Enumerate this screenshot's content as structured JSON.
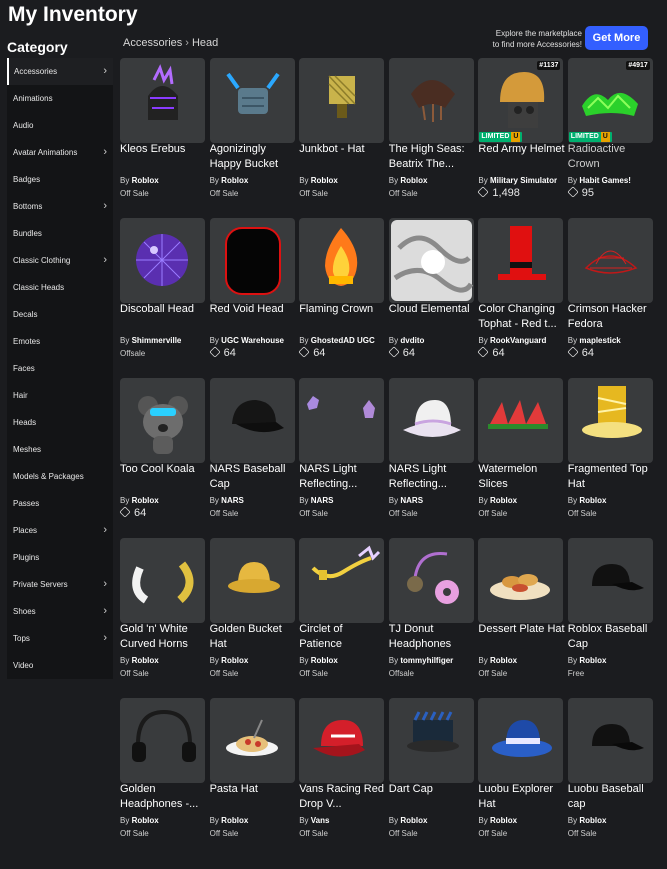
{
  "page_title": "My Inventory",
  "category_title": "Category",
  "sidebar": {
    "items": [
      {
        "label": "Accessories",
        "chevron": true,
        "active": true
      },
      {
        "label": "Animations",
        "chevron": false
      },
      {
        "label": "Audio",
        "chevron": false
      },
      {
        "label": "Avatar Animations",
        "chevron": true
      },
      {
        "label": "Badges",
        "chevron": false
      },
      {
        "label": "Bottoms",
        "chevron": true
      },
      {
        "label": "Bundles",
        "chevron": false
      },
      {
        "label": "Classic Clothing",
        "chevron": true
      },
      {
        "label": "Classic Heads",
        "chevron": false
      },
      {
        "label": "Decals",
        "chevron": false
      },
      {
        "label": "Emotes",
        "chevron": false
      },
      {
        "label": "Faces",
        "chevron": false
      },
      {
        "label": "Hair",
        "chevron": false
      },
      {
        "label": "Heads",
        "chevron": false
      },
      {
        "label": "Meshes",
        "chevron": false
      },
      {
        "label": "Models & Packages",
        "chevron": false
      },
      {
        "label": "Passes",
        "chevron": false
      },
      {
        "label": "Places",
        "chevron": true
      },
      {
        "label": "Plugins",
        "chevron": false
      },
      {
        "label": "Private Servers",
        "chevron": true
      },
      {
        "label": "Shoes",
        "chevron": true
      },
      {
        "label": "Tops",
        "chevron": true
      },
      {
        "label": "Video",
        "chevron": false
      }
    ]
  },
  "breadcrumb": {
    "parent": "Accessories",
    "separator": "›",
    "current": "Head"
  },
  "promo": {
    "line1": "Explore the marketplace",
    "line2": "to find more Accessories!",
    "button": "Get More"
  },
  "by_prefix": "By",
  "items": [
    {
      "name": "Kleos Erebus",
      "creator": "Roblox",
      "price": "Off Sale",
      "icon": "dark-helmet-icon"
    },
    {
      "name": "Agonizingly Happy Bucket",
      "creator": "Roblox",
      "price": "Off Sale",
      "icon": "bucket-horns-icon"
    },
    {
      "name": "Junkbot - Hat",
      "creator": "Roblox",
      "price": "Off Sale",
      "icon": "junkbot-hat-icon"
    },
    {
      "name": "The High Seas: Beatrix The...",
      "creator": "Roblox",
      "price": "Off Sale",
      "icon": "pirate-hat-icon"
    },
    {
      "name": "Red Army Helmet",
      "creator": "Military Simulator",
      "price": "1,498",
      "robux": true,
      "limited": "LIMITED",
      "limited_u": "U",
      "serial": "#1137",
      "icon": "army-helmet-icon"
    },
    {
      "name": "Radioactive Crown",
      "creator": "Habit Games!",
      "price": "95",
      "robux": true,
      "limited": "LIMITED",
      "limited_u": "U",
      "serial": "#4917",
      "dim": true,
      "icon": "radioactive-crown-icon"
    },
    {
      "name": "Discoball Head",
      "creator": "Shimmerville",
      "price": "Offsale",
      "icon": "discoball-icon"
    },
    {
      "name": "Red Void Head",
      "creator": "UGC Warehouse",
      "price": "64",
      "robux": true,
      "icon": "void-head-icon"
    },
    {
      "name": "Flaming Crown",
      "creator": "GhostedAD UGC",
      "price": "64",
      "robux": true,
      "icon": "flaming-crown-icon"
    },
    {
      "name": "Cloud Elemental",
      "creator": "dvdito",
      "price": "64",
      "robux": true,
      "icon": "cloud-elemental-icon"
    },
    {
      "name": "Color Changing Tophat - Red t...",
      "creator": "RookVanguard",
      "price": "64",
      "robux": true,
      "icon": "red-tophat-icon"
    },
    {
      "name": "Crimson Hacker Fedora",
      "creator": "maplestick",
      "price": "64",
      "robux": true,
      "icon": "wire-fedora-icon"
    },
    {
      "name": "Too Cool Koala",
      "creator": "Roblox",
      "price": "64",
      "robux": true,
      "icon": "koala-icon"
    },
    {
      "name": "NARS Baseball Cap",
      "creator": "NARS",
      "price": "Off Sale",
      "icon": "black-cap-icon"
    },
    {
      "name": "NARS Light Reflecting...",
      "creator": "NARS",
      "price": "Off Sale",
      "icon": "crystals-icon"
    },
    {
      "name": "NARS Light Reflecting...",
      "creator": "NARS",
      "price": "Off Sale",
      "icon": "bucket-hat-icon"
    },
    {
      "name": "Watermelon Slices",
      "creator": "Roblox",
      "price": "Off Sale",
      "icon": "watermelon-icon"
    },
    {
      "name": "Fragmented Top Hat",
      "creator": "Roblox",
      "price": "Off Sale",
      "icon": "gold-tophat-icon"
    },
    {
      "name": "Gold 'n' White Curved Horns",
      "creator": "Roblox",
      "price": "Off Sale",
      "icon": "horns-icon"
    },
    {
      "name": "Golden Bucket Hat",
      "creator": "Roblox",
      "price": "Off Sale",
      "icon": "golden-bucket-icon"
    },
    {
      "name": "Circlet of Patience",
      "creator": "Roblox",
      "price": "Off Sale",
      "icon": "circlet-icon"
    },
    {
      "name": "TJ Donut Headphones",
      "creator": "tommyhilfiger",
      "price": "Offsale",
      "icon": "donut-headphones-icon"
    },
    {
      "name": "Dessert Plate Hat",
      "creator": "Roblox",
      "price": "Off Sale",
      "icon": "dessert-plate-icon"
    },
    {
      "name": "Roblox Baseball Cap",
      "creator": "Roblox",
      "price": "Free",
      "icon": "roblox-cap-icon"
    },
    {
      "name": "Golden Headphones -...",
      "creator": "Roblox",
      "price": "Off Sale",
      "icon": "headphones-icon"
    },
    {
      "name": "Pasta Hat",
      "creator": "Roblox",
      "price": "Off Sale",
      "icon": "pasta-hat-icon"
    },
    {
      "name": "Vans Racing Red Drop V...",
      "creator": "Vans",
      "price": "Off Sale",
      "icon": "vans-cap-icon"
    },
    {
      "name": "Dart Cap",
      "creator": "Roblox",
      "price": "Off Sale",
      "icon": "dart-cap-icon"
    },
    {
      "name": "Luobu Explorer Hat",
      "creator": "Roblox",
      "price": "Off Sale",
      "icon": "explorer-hat-icon"
    },
    {
      "name": "Luobu Baseball cap",
      "creator": "Roblox",
      "price": "Off Sale",
      "icon": "luobu-cap-icon"
    }
  ]
}
